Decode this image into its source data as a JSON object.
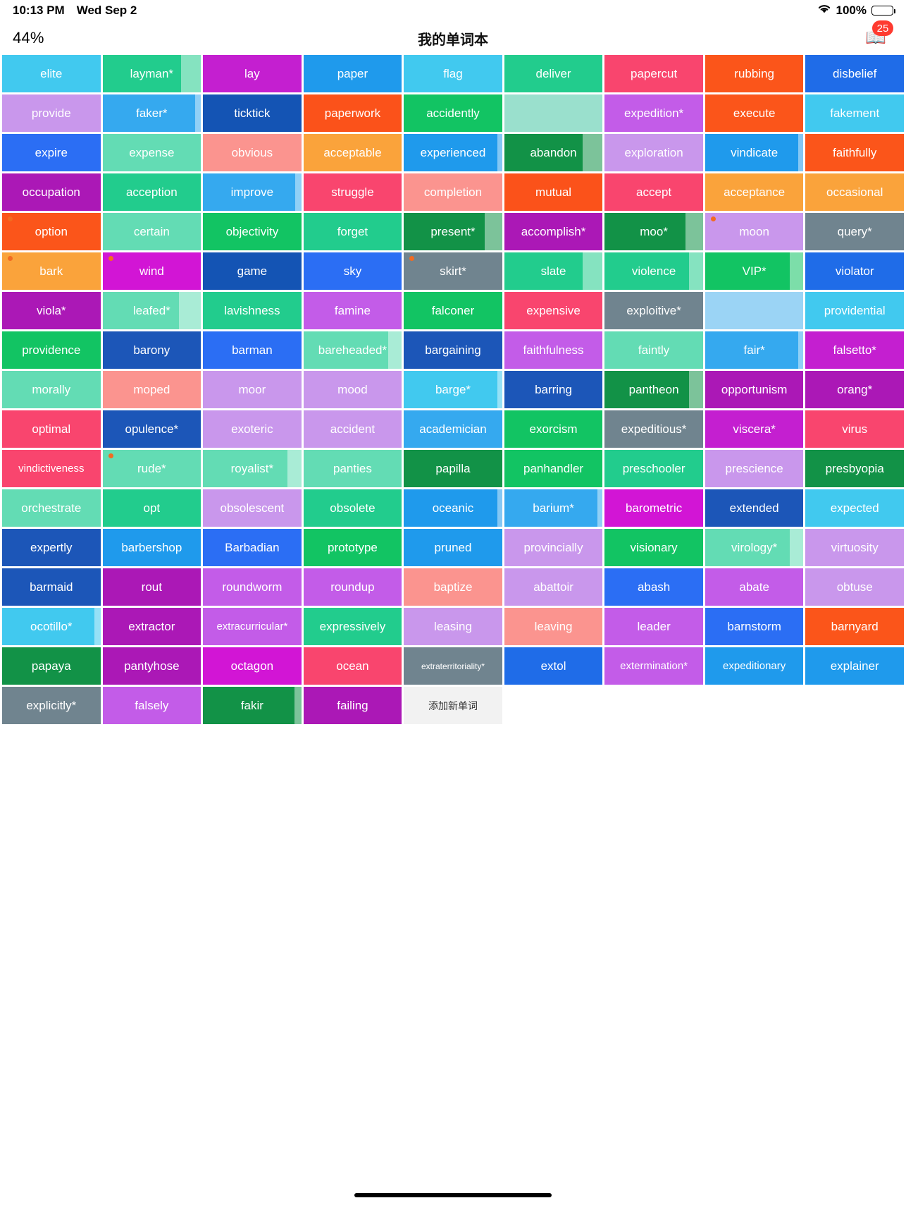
{
  "status_bar": {
    "time": "10:13 PM",
    "date": "Wed Sep 2",
    "wifi_icon": "wifi-icon",
    "battery_percent": "100%",
    "battery_icon": "battery-full-icon"
  },
  "nav": {
    "progress_percent": "44%",
    "title": "我的单词本",
    "book_icon": "book-icon",
    "badge_count": "25"
  },
  "add_tile": {
    "label": "添加新单词"
  },
  "colors": {
    "accent_dot": "#f26b21",
    "badge_red": "#fe3b30",
    "add_tile_bg": "#f2f2f2"
  },
  "tiles": [
    {
      "label": "elite",
      "color": "#41c9ef",
      "progress": 0,
      "dot": false
    },
    {
      "label": "layman*",
      "color": "#22cc8d",
      "progress": 20,
      "dot": false
    },
    {
      "label": "lay",
      "color": "#c41fd0",
      "progress": 0,
      "dot": false
    },
    {
      "label": "paper",
      "color": "#1f9aec",
      "progress": 0,
      "dot": false
    },
    {
      "label": "flag",
      "color": "#41c9ef",
      "progress": 0,
      "dot": false
    },
    {
      "label": "deliver",
      "color": "#22cc8d",
      "progress": 0,
      "dot": false
    },
    {
      "label": "papercut",
      "color": "#f9456e",
      "progress": 0,
      "dot": false
    },
    {
      "label": "rubbing",
      "color": "#fb551a",
      "progress": 0,
      "dot": false
    },
    {
      "label": "disbelief",
      "color": "#1f6ce8",
      "progress": 0,
      "dot": false
    },
    {
      "label": "provide",
      "color": "#c997ec",
      "progress": 0,
      "dot": false
    },
    {
      "label": "faker*",
      "color": "#35a9ef",
      "progress": 6,
      "dot": false
    },
    {
      "label": "ticktick",
      "color": "#1454b4",
      "progress": 0,
      "dot": false
    },
    {
      "label": "paperwork",
      "color": "#fb521a",
      "progress": 0,
      "dot": false
    },
    {
      "label": "accidently",
      "color": "#12c463",
      "progress": 0,
      "dot": false
    },
    {
      "label": "",
      "color": "#9ae0cd",
      "progress": 0,
      "dot": false,
      "empty": true
    },
    {
      "label": "expedition*",
      "color": "#c35ce8",
      "progress": 0,
      "dot": false
    },
    {
      "label": "execute",
      "color": "#fb551a",
      "progress": 0,
      "dot": false
    },
    {
      "label": "fakement",
      "color": "#41c9ef",
      "progress": 0,
      "dot": false
    },
    {
      "label": "expire",
      "color": "#2b6ef4",
      "progress": 0,
      "dot": false
    },
    {
      "label": "expense",
      "color": "#63dcb4",
      "progress": 0,
      "dot": false
    },
    {
      "label": "obvious",
      "color": "#fb948f",
      "progress": 0,
      "dot": false
    },
    {
      "label": "acceptable",
      "color": "#faa33b",
      "progress": 0,
      "dot": false
    },
    {
      "label": "experienced",
      "color": "#1f9aec",
      "progress": 5,
      "dot": false
    },
    {
      "label": "abandon",
      "color": "#129247",
      "progress": 20,
      "dot": false
    },
    {
      "label": "exploration",
      "color": "#c997ec",
      "progress": 0,
      "dot": false
    },
    {
      "label": "vindicate",
      "color": "#1f9aec",
      "progress": 5,
      "dot": false
    },
    {
      "label": "faithfully",
      "color": "#fb551a",
      "progress": 0,
      "dot": false
    },
    {
      "label": "occupation",
      "color": "#ab18b6",
      "progress": 0,
      "dot": false
    },
    {
      "label": "acception",
      "color": "#22cc8d",
      "progress": 0,
      "dot": false
    },
    {
      "label": "improve",
      "color": "#35a9ef",
      "progress": 6,
      "dot": false
    },
    {
      "label": "struggle",
      "color": "#f9456e",
      "progress": 0,
      "dot": false
    },
    {
      "label": "completion",
      "color": "#fb948f",
      "progress": 0,
      "dot": false
    },
    {
      "label": "mutual",
      "color": "#fb521a",
      "progress": 0,
      "dot": false
    },
    {
      "label": "accept",
      "color": "#f9456e",
      "progress": 0,
      "dot": false
    },
    {
      "label": "acceptance",
      "color": "#faa33b",
      "progress": 0,
      "dot": false
    },
    {
      "label": "occasional",
      "color": "#faa33b",
      "progress": 0,
      "dot": false
    },
    {
      "label": "option",
      "color": "#fb551a",
      "progress": 0,
      "dot": true
    },
    {
      "label": "certain",
      "color": "#63dcb4",
      "progress": 0,
      "dot": false
    },
    {
      "label": "objectivity",
      "color": "#12c463",
      "progress": 0,
      "dot": false
    },
    {
      "label": "forget",
      "color": "#22cc8d",
      "progress": 0,
      "dot": false
    },
    {
      "label": "present*",
      "color": "#129247",
      "progress": 18,
      "dot": false
    },
    {
      "label": "accomplish*",
      "color": "#ab18b6",
      "progress": 0,
      "dot": false
    },
    {
      "label": "moo*",
      "color": "#129247",
      "progress": 18,
      "dot": false
    },
    {
      "label": "moon",
      "color": "#c997ec",
      "progress": 0,
      "dot": true
    },
    {
      "label": "query*",
      "color": "#70848f",
      "progress": 0,
      "dot": false
    },
    {
      "label": "bark",
      "color": "#faa33b",
      "progress": 0,
      "dot": true
    },
    {
      "label": "wind",
      "color": "#d215d5",
      "progress": 0,
      "dot": true
    },
    {
      "label": "game",
      "color": "#1454b4",
      "progress": 0,
      "dot": false
    },
    {
      "label": "sky",
      "color": "#2b6ef4",
      "progress": 0,
      "dot": false
    },
    {
      "label": "skirt*",
      "color": "#70848f",
      "progress": 0,
      "dot": true
    },
    {
      "label": "slate",
      "color": "#22cc8d",
      "progress": 20,
      "dot": false
    },
    {
      "label": "violence",
      "color": "#22cc8d",
      "progress": 14,
      "dot": false
    },
    {
      "label": "VIP*",
      "color": "#12c463",
      "progress": 14,
      "dot": false
    },
    {
      "label": "violator",
      "color": "#1f6ce8",
      "progress": 0,
      "dot": false
    },
    {
      "label": "viola*",
      "color": "#ab18b6",
      "progress": 0,
      "dot": false
    },
    {
      "label": "leafed*",
      "color": "#63dcb4",
      "progress": 22,
      "dot": false
    },
    {
      "label": "lavishness",
      "color": "#22cc8d",
      "progress": 0,
      "dot": false
    },
    {
      "label": "famine",
      "color": "#c35ce8",
      "progress": 0,
      "dot": false
    },
    {
      "label": "falconer",
      "color": "#12c463",
      "progress": 0,
      "dot": false
    },
    {
      "label": "expensive",
      "color": "#f9456e",
      "progress": 0,
      "dot": false
    },
    {
      "label": "exploitive*",
      "color": "#70848f",
      "progress": 0,
      "dot": false
    },
    {
      "label": "",
      "color": "#9bd4f5",
      "progress": 0,
      "dot": false,
      "empty": true
    },
    {
      "label": "providential",
      "color": "#41c9ef",
      "progress": 0,
      "dot": false
    },
    {
      "label": "providence",
      "color": "#12c463",
      "progress": 0,
      "dot": false
    },
    {
      "label": "barony",
      "color": "#1c56b8",
      "progress": 0,
      "dot": false
    },
    {
      "label": "barman",
      "color": "#2b6ef4",
      "progress": 0,
      "dot": false
    },
    {
      "label": "bareheaded*",
      "color": "#63dcb4",
      "progress": 14,
      "dot": false
    },
    {
      "label": "bargaining",
      "color": "#1c56b8",
      "progress": 0,
      "dot": false
    },
    {
      "label": "faithfulness",
      "color": "#c35ce8",
      "progress": 0,
      "dot": false
    },
    {
      "label": "faintly",
      "color": "#63dcb4",
      "progress": 0,
      "dot": false
    },
    {
      "label": "fair*",
      "color": "#35a9ef",
      "progress": 5,
      "dot": false
    },
    {
      "label": "falsetto*",
      "color": "#c41fd0",
      "progress": 0,
      "dot": false
    },
    {
      "label": "morally",
      "color": "#63dcb4",
      "progress": 0,
      "dot": false
    },
    {
      "label": "moped",
      "color": "#fb948f",
      "progress": 0,
      "dot": false
    },
    {
      "label": "moor",
      "color": "#c997ec",
      "progress": 0,
      "dot": false
    },
    {
      "label": "mood",
      "color": "#c997ec",
      "progress": 0,
      "dot": false
    },
    {
      "label": "barge*",
      "color": "#41c9ef",
      "progress": 5,
      "dot": false
    },
    {
      "label": "barring",
      "color": "#1c56b8",
      "progress": 0,
      "dot": false
    },
    {
      "label": "pantheon",
      "color": "#129247",
      "progress": 14,
      "dot": false
    },
    {
      "label": "opportunism",
      "color": "#ab18b6",
      "progress": 0,
      "dot": false
    },
    {
      "label": "orang*",
      "color": "#ab18b6",
      "progress": 0,
      "dot": false
    },
    {
      "label": "optimal",
      "color": "#f9456e",
      "progress": 0,
      "dot": false
    },
    {
      "label": "opulence*",
      "color": "#1c56b8",
      "progress": 0,
      "dot": false
    },
    {
      "label": "exoteric",
      "color": "#c997ec",
      "progress": 0,
      "dot": false
    },
    {
      "label": "accident",
      "color": "#c997ec",
      "progress": 0,
      "dot": false
    },
    {
      "label": "academician",
      "color": "#35a9ef",
      "progress": 0,
      "dot": false
    },
    {
      "label": "exorcism",
      "color": "#12c463",
      "progress": 0,
      "dot": false
    },
    {
      "label": "expeditious*",
      "color": "#70848f",
      "progress": 0,
      "dot": false
    },
    {
      "label": "viscera*",
      "color": "#c41fd0",
      "progress": 0,
      "dot": false
    },
    {
      "label": "virus",
      "color": "#f9456e",
      "progress": 0,
      "dot": false
    },
    {
      "label": "vindictiveness",
      "color": "#f9456e",
      "progress": 0,
      "dot": false
    },
    {
      "label": "rude*",
      "color": "#63dcb4",
      "progress": 0,
      "dot": true
    },
    {
      "label": "royalist*",
      "color": "#63dcb4",
      "progress": 14,
      "dot": false
    },
    {
      "label": "panties",
      "color": "#63dcb4",
      "progress": 0,
      "dot": false
    },
    {
      "label": "papilla",
      "color": "#129247",
      "progress": 0,
      "dot": false
    },
    {
      "label": "panhandler",
      "color": "#12c463",
      "progress": 0,
      "dot": false
    },
    {
      "label": "preschooler",
      "color": "#22cc8d",
      "progress": 0,
      "dot": false
    },
    {
      "label": "prescience",
      "color": "#c997ec",
      "progress": 0,
      "dot": false
    },
    {
      "label": "presbyopia",
      "color": "#129247",
      "progress": 0,
      "dot": false
    },
    {
      "label": "orchestrate",
      "color": "#63dcb4",
      "progress": 0,
      "dot": false
    },
    {
      "label": "opt",
      "color": "#22cc8d",
      "progress": 0,
      "dot": false
    },
    {
      "label": "obsolescent",
      "color": "#c997ec",
      "progress": 0,
      "dot": false
    },
    {
      "label": "obsolete",
      "color": "#22cc8d",
      "progress": 0,
      "dot": false
    },
    {
      "label": "oceanic",
      "color": "#1f9aec",
      "progress": 5,
      "dot": false
    },
    {
      "label": "barium*",
      "color": "#35a9ef",
      "progress": 5,
      "dot": false
    },
    {
      "label": "barometric",
      "color": "#d215d5",
      "progress": 0,
      "dot": false
    },
    {
      "label": "extended",
      "color": "#1c56b8",
      "progress": 0,
      "dot": false
    },
    {
      "label": "expected",
      "color": "#41c9ef",
      "progress": 0,
      "dot": false
    },
    {
      "label": "expertly",
      "color": "#1c56b8",
      "progress": 0,
      "dot": false
    },
    {
      "label": "barbershop",
      "color": "#1f9aec",
      "progress": 0,
      "dot": false
    },
    {
      "label": "Barbadian",
      "color": "#2b6ef4",
      "progress": 0,
      "dot": false
    },
    {
      "label": "prototype",
      "color": "#12c463",
      "progress": 0,
      "dot": false
    },
    {
      "label": "pruned",
      "color": "#1f9aec",
      "progress": 0,
      "dot": false
    },
    {
      "label": "provincially",
      "color": "#c997ec",
      "progress": 0,
      "dot": false
    },
    {
      "label": "visionary",
      "color": "#12c463",
      "progress": 0,
      "dot": false
    },
    {
      "label": "virology*",
      "color": "#63dcb4",
      "progress": 14,
      "dot": false
    },
    {
      "label": "virtuosity",
      "color": "#c997ec",
      "progress": 0,
      "dot": false
    },
    {
      "label": "barmaid",
      "color": "#1c56b8",
      "progress": 0,
      "dot": false
    },
    {
      "label": "rout",
      "color": "#ab18b6",
      "progress": 0,
      "dot": false
    },
    {
      "label": "roundworm",
      "color": "#c35ce8",
      "progress": 0,
      "dot": false
    },
    {
      "label": "roundup",
      "color": "#c35ce8",
      "progress": 0,
      "dot": false
    },
    {
      "label": "baptize",
      "color": "#fb948f",
      "progress": 0,
      "dot": false
    },
    {
      "label": "abattoir",
      "color": "#c997ec",
      "progress": 0,
      "dot": false
    },
    {
      "label": "abash",
      "color": "#2b6ef4",
      "progress": 0,
      "dot": false
    },
    {
      "label": "abate",
      "color": "#c35ce8",
      "progress": 0,
      "dot": false
    },
    {
      "label": "obtuse",
      "color": "#c997ec",
      "progress": 0,
      "dot": false
    },
    {
      "label": "ocotillo*",
      "color": "#41c9ef",
      "progress": 6,
      "dot": false
    },
    {
      "label": "extractor",
      "color": "#ab18b6",
      "progress": 0,
      "dot": false
    },
    {
      "label": "extracurricular*",
      "color": "#c35ce8",
      "progress": 0,
      "dot": false
    },
    {
      "label": "expressively",
      "color": "#22cc8d",
      "progress": 0,
      "dot": false
    },
    {
      "label": "leasing",
      "color": "#c997ec",
      "progress": 0,
      "dot": false
    },
    {
      "label": "leaving",
      "color": "#fb948f",
      "progress": 0,
      "dot": false
    },
    {
      "label": "leader",
      "color": "#c35ce8",
      "progress": 0,
      "dot": false
    },
    {
      "label": "barnstorm",
      "color": "#2b6ef4",
      "progress": 0,
      "dot": false
    },
    {
      "label": "barnyard",
      "color": "#fb551a",
      "progress": 0,
      "dot": false
    },
    {
      "label": "papaya",
      "color": "#129247",
      "progress": 0,
      "dot": false
    },
    {
      "label": "pantyhose",
      "color": "#ab18b6",
      "progress": 0,
      "dot": false
    },
    {
      "label": "octagon",
      "color": "#d215d5",
      "progress": 0,
      "dot": false
    },
    {
      "label": "ocean",
      "color": "#f9456e",
      "progress": 0,
      "dot": false
    },
    {
      "label": "extraterritoriality*",
      "color": "#70848f",
      "progress": 0,
      "dot": false
    },
    {
      "label": "extol",
      "color": "#1f6ce8",
      "progress": 0,
      "dot": false
    },
    {
      "label": "extermination*",
      "color": "#c35ce8",
      "progress": 0,
      "dot": false
    },
    {
      "label": "expeditionary",
      "color": "#1f9aec",
      "progress": 0,
      "dot": false
    },
    {
      "label": "explainer",
      "color": "#1f9aec",
      "progress": 0,
      "dot": false
    },
    {
      "label": "explicitly*",
      "color": "#70848f",
      "progress": 0,
      "dot": false
    },
    {
      "label": "falsely",
      "color": "#c35ce8",
      "progress": 0,
      "dot": false
    },
    {
      "label": "fakir",
      "color": "#129247",
      "progress": 7,
      "dot": false
    },
    {
      "label": "failing",
      "color": "#ab18b6",
      "progress": 0,
      "dot": false
    }
  ]
}
